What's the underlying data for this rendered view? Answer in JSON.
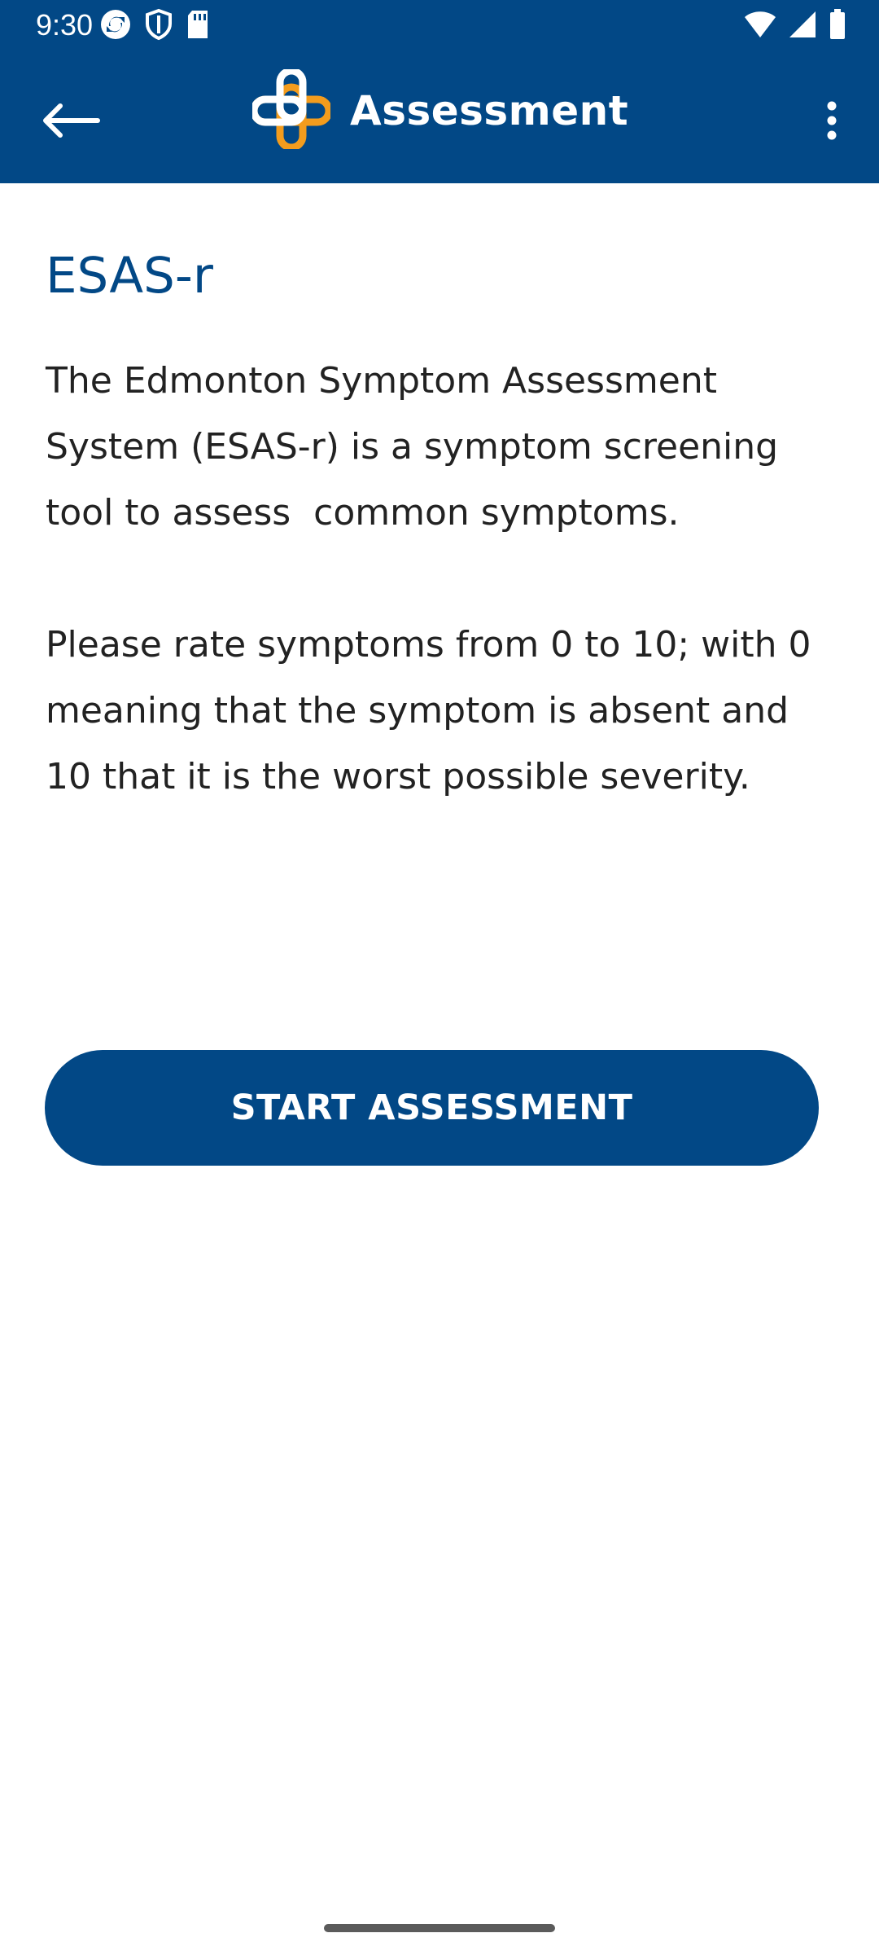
{
  "status_bar": {
    "time": "9:30",
    "left_icons": [
      "sync-icon",
      "shield-icon",
      "sd-card-icon"
    ],
    "right_icons": [
      "wifi-icon",
      "signal-icon",
      "battery-icon"
    ]
  },
  "app_bar": {
    "title": "Assessment",
    "back_icon": "arrow-back-icon",
    "logo_icon": "cross-logo-icon",
    "menu_icon": "more-vert-icon"
  },
  "content": {
    "title": "ESAS-r",
    "intro": "The Edmonton Symptom Assessment System (ESAS-r) is a symptom screening tool to assess  common symptoms.",
    "instructions": "Please rate symptoms from 0 to 10; with 0 meaning that the symptom is absent and 10 that it is the worst possible severity."
  },
  "actions": {
    "start_label": "START ASSESSMENT"
  },
  "colors": {
    "primary": "#024886",
    "logo_orange": "#F39C1D",
    "text": "#222222",
    "background": "#FFFFFF"
  }
}
